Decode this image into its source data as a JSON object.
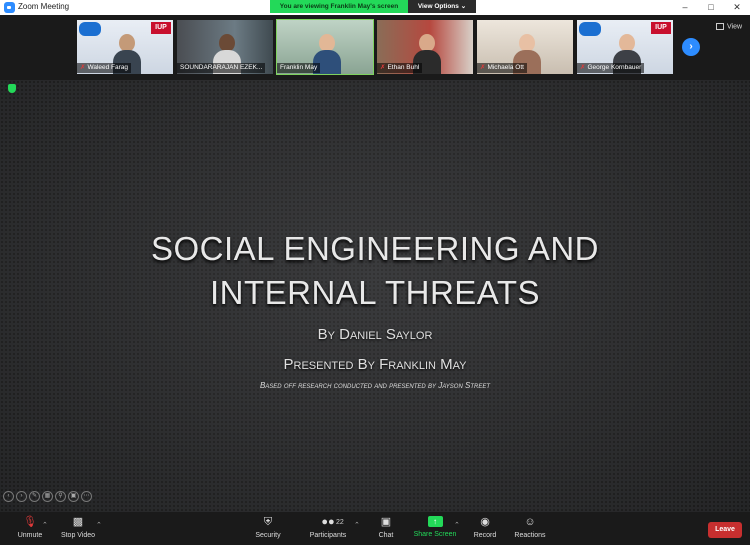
{
  "window": {
    "title": "Zoom Meeting",
    "controls": [
      "minimize-icon",
      "maximize-icon",
      "close-icon"
    ]
  },
  "banner": {
    "viewing": "You are viewing Franklin May's screen",
    "view_options": "View Options ⌄"
  },
  "gallery": {
    "participants": [
      {
        "name": "Waleed Farag",
        "muted": true
      },
      {
        "name": "SOUNDARARAJAN EZEK...",
        "muted": false
      },
      {
        "name": "Franklin May",
        "muted": false,
        "active": true
      },
      {
        "name": "Ethan Buhl",
        "muted": true
      },
      {
        "name": "Michaela Ott",
        "muted": true
      },
      {
        "name": "George Kornbauer",
        "muted": true
      }
    ],
    "brand_text": "IUP",
    "next_icon": "›",
    "view_label": "View"
  },
  "slide": {
    "title_line1": "Social Engineering and",
    "title_line2": "Internal Threats",
    "author": "By Daniel Saylor",
    "presenter": "Presented By Franklin May",
    "note": "Based off research conducted and presented by Jayson Street"
  },
  "toolbar": {
    "unmute": "Unmute",
    "stop_video": "Stop Video",
    "security": "Security",
    "participants": "Participants",
    "participants_count": "22",
    "chat": "Chat",
    "share_screen": "Share Screen",
    "record": "Record",
    "reactions": "Reactions",
    "leave": "Leave"
  },
  "colors": {
    "accent_green": "#23d959",
    "zoom_blue": "#2d8cff",
    "leave_red": "#c72f2f",
    "mute_red": "#e03a3a"
  }
}
